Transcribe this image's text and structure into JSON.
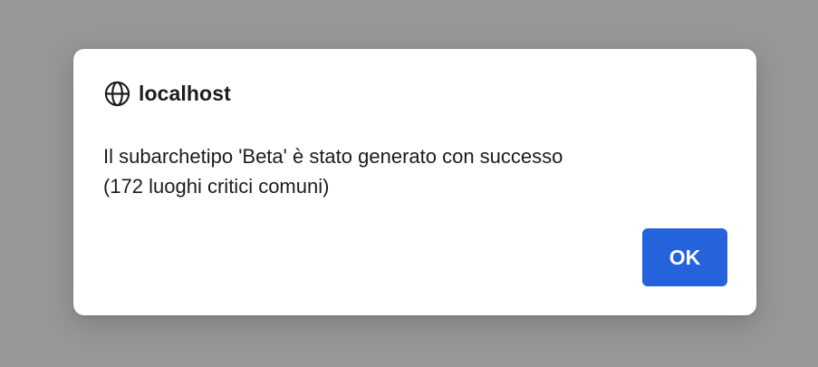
{
  "dialog": {
    "host": "localhost",
    "host_icon": "globe-icon",
    "message_line1": "Il subarchetipo 'Beta' è stato generato con successo",
    "message_line2": "(172 luoghi critici comuni)",
    "ok_label": "OK"
  },
  "colors": {
    "overlay": "#979799",
    "dialog_background": "#ffffff",
    "primary_button": "#2463dc",
    "text": "#1c1c1e"
  }
}
